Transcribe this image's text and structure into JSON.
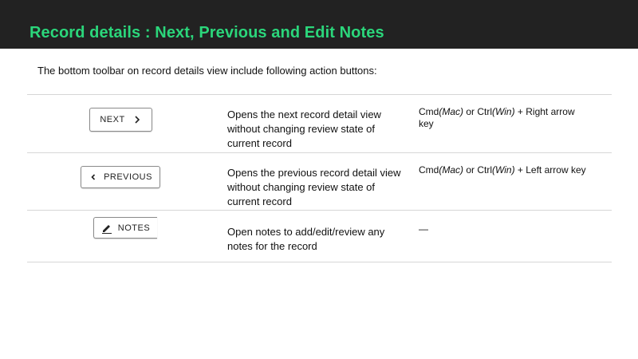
{
  "header": {
    "title": "Record details : Next, Previous and Edit Notes",
    "background": "#222222",
    "title_color": "#2bd67b"
  },
  "intro": "The bottom toolbar on record details view include following action buttons:",
  "rows": [
    {
      "button_label": "NEXT",
      "button_icon": "chevron-right-icon",
      "description": "Opens the next record detail view without changing review state of current record",
      "shortcut": {
        "p1": "Cmd",
        "p2": "(Mac)",
        "p3": " or Ctrl",
        "p4": "(Win)",
        "p5": " + Right arrow key"
      }
    },
    {
      "button_label": "PREVIOUS",
      "button_icon": "chevron-left-icon",
      "description": "Opens the previous record detail view without changing review state of current record",
      "shortcut": {
        "p1": "Cmd",
        "p2": "(Mac)",
        "p3": " or Ctrl",
        "p4": "(Win)",
        "p5": " + Left arrow key"
      }
    },
    {
      "button_label": "NOTES",
      "button_icon": "pencil-icon",
      "description": "Open notes to add/edit/review any notes for the record",
      "shortcut_text": "—"
    }
  ]
}
